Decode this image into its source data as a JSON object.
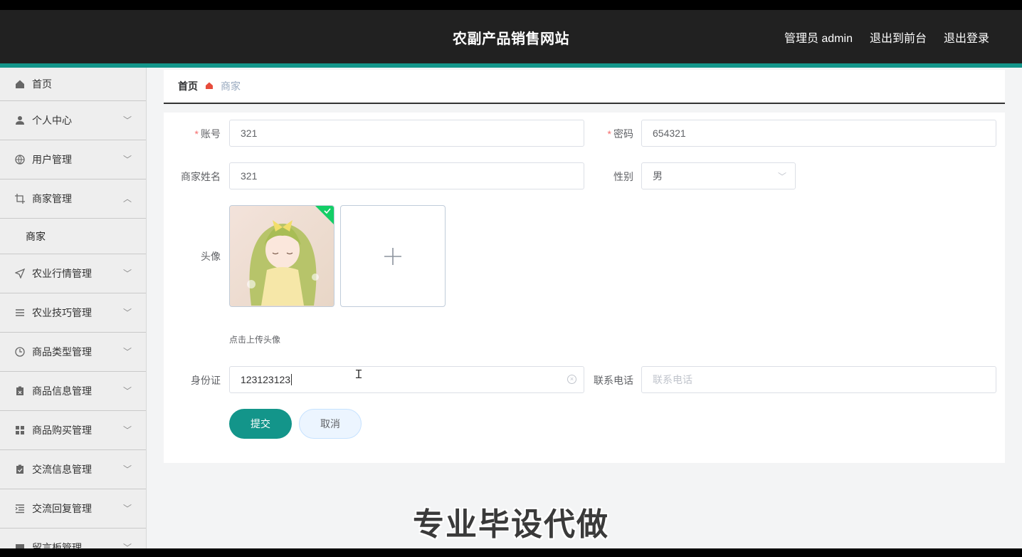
{
  "header": {
    "title": "农副产品销售网站",
    "user_label": "管理员 admin",
    "front_link": "退出到前台",
    "logout_link": "退出登录"
  },
  "sidebar": {
    "items": [
      {
        "label": "首页",
        "icon": "home-icon"
      },
      {
        "label": "个人中心",
        "icon": "user-icon"
      },
      {
        "label": "用户管理",
        "icon": "globe-icon"
      },
      {
        "label": "商家管理",
        "icon": "crop-icon",
        "expanded": true,
        "sub": [
          "商家"
        ]
      },
      {
        "label": "农业行情管理",
        "icon": "send-icon"
      },
      {
        "label": "农业技巧管理",
        "icon": "list-icon"
      },
      {
        "label": "商品类型管理",
        "icon": "clock-icon"
      },
      {
        "label": "商品信息管理",
        "icon": "clipboard-icon"
      },
      {
        "label": "商品购买管理",
        "icon": "grid-icon"
      },
      {
        "label": "交流信息管理",
        "icon": "checklist-icon"
      },
      {
        "label": "交流回复管理",
        "icon": "indent-icon"
      },
      {
        "label": "留言板管理",
        "icon": "message-icon"
      }
    ]
  },
  "breadcrumb": {
    "home": "首页",
    "current": "商家"
  },
  "form": {
    "account_label": "账号",
    "account_value": "321",
    "password_label": "密码",
    "password_value": "654321",
    "name_label": "商家姓名",
    "name_value": "321",
    "gender_label": "性别",
    "gender_value": "男",
    "avatar_label": "头像",
    "avatar_hint": "点击上传头像",
    "id_label": "身份证",
    "id_value": "123123123",
    "phone_label": "联系电话",
    "phone_placeholder": "联系电话",
    "submit": "提交",
    "cancel": "取消"
  },
  "colors": {
    "accent": "#13958a",
    "header_bg": "#212121"
  },
  "watermark": "专业毕设代做"
}
